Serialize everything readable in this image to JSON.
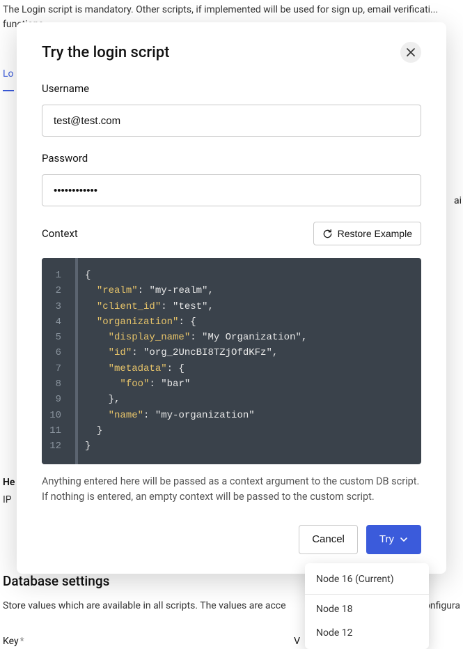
{
  "background": {
    "line1": "The Login script is mandatory. Other scripts, if implemented will be used for sign up, email verificati...",
    "line2": "functions.",
    "tab": "Lo",
    "he": "He",
    "ip": "IP",
    "ai": "ai",
    "dbHeading": "Database settings",
    "dbDesc": "Store values which are available in all scripts. The values are acce",
    "dbDescEnd": "onfigura",
    "keyLabel": "Key",
    "vLabel": "V"
  },
  "modal": {
    "title": "Try the login script",
    "usernameLabel": "Username",
    "usernameValue": "test@test.com",
    "passwordLabel": "Password",
    "passwordValue": "••••••••••••",
    "contextLabel": "Context",
    "restoreLabel": "Restore Example",
    "contextHelp": "Anything entered here will be passed as a context argument to the custom DB script. If nothing is entered, an empty context will be passed to the custom script.",
    "cancelLabel": "Cancel",
    "tryLabel": "Try",
    "code": {
      "realm_key": "\"realm\"",
      "realm_val": "\"my-realm\"",
      "client_id_key": "\"client_id\"",
      "client_id_val": "\"test\"",
      "organization_key": "\"organization\"",
      "display_name_key": "\"display_name\"",
      "display_name_val": "\"My Organization\"",
      "id_key": "\"id\"",
      "id_val": "\"org_2UncBI8TZjOfdKFz\"",
      "metadata_key": "\"metadata\"",
      "foo_key": "\"foo\"",
      "foo_val": "\"bar\"",
      "name_key": "\"name\"",
      "name_val": "\"my-organization\""
    }
  },
  "dropdown": {
    "item1": "Node 16 (Current)",
    "item2": "Node 18",
    "item3": "Node 12"
  }
}
